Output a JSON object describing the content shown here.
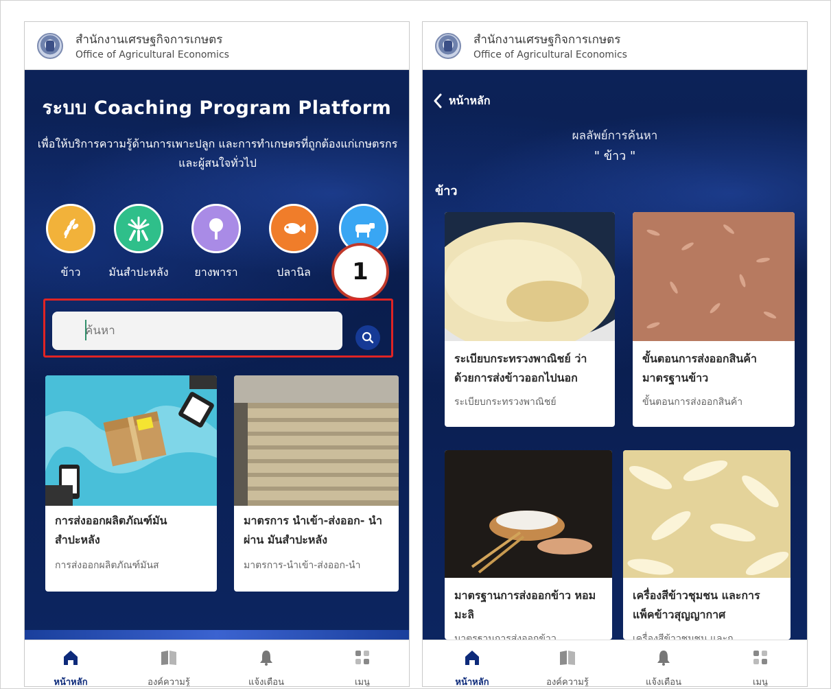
{
  "org": {
    "name_th": "สำนักงานเศรษฐกิจการเกษตร",
    "name_en": "Office of Agricultural Economics"
  },
  "left": {
    "title": "ระบบ Coaching Program Platform",
    "subtitle": "เพื่อให้บริการความรู้ด้านการเพาะปลูก และการทำเกษตรที่ถูกต้องแก่เกษตรกร และผู้สนใจทั่วไป",
    "categories": [
      {
        "label": "ข้าว",
        "icon": "rice-icon",
        "color": "#f2b23a"
      },
      {
        "label": "มันสำปะหลัง",
        "icon": "cassava-icon",
        "color": "#2fbf8a"
      },
      {
        "label": "ยางพารา",
        "icon": "rubber-icon",
        "color": "#a98be6"
      },
      {
        "label": "ปลานิล",
        "icon": "fish-icon",
        "color": "#f07d2a"
      },
      {
        "label": "",
        "icon": "cow-icon",
        "color": "#39a6f3"
      }
    ],
    "badge": "1",
    "search": {
      "placeholder": "ค้นหา"
    },
    "cards": [
      {
        "title": "การส่งออกผลิตภัณฑ์มัน สำปะหลัง",
        "subtitle": "การส่งออกผลิตภัณฑ์มันส"
      },
      {
        "title": "มาตรการ นำเข้า-ส่งออก- นำผ่าน มันสำปะหลัง",
        "subtitle": "มาตรการ-นำเข้า-ส่งออก-นำ"
      }
    ]
  },
  "right": {
    "back_label": "หน้าหลัก",
    "result_title": "ผลลัพย์การค้นหา",
    "result_query": "\" ข้าว \"",
    "section": "ข้าว",
    "cards": [
      {
        "title": "ระเบียบกระทรวงพาณิชย์ ว่า ด้วยการส่งข้าวออกไปนอก",
        "subtitle": "ระเบียบกระทรวงพาณิชย์"
      },
      {
        "title": "ขั้นตอนการส่งออกสินค้า มาตรฐานข้าว",
        "subtitle": "ขั้นตอนการส่งออกสินค้า"
      },
      {
        "title": "มาตรฐานการส่งออกข้าว หอมมะลิ",
        "subtitle": "มาตรฐานการส่งออกข้าว"
      },
      {
        "title": "เครื่องสีข้าวชุมชน และการ แพ็คข้าวสุญญากาศ",
        "subtitle": "เครื่องสีข้าวชุมชน และก"
      }
    ]
  },
  "nav": [
    {
      "label": "หน้าหลัก",
      "icon": "home-icon",
      "active": true
    },
    {
      "label": "องค์ความรู้",
      "icon": "book-icon",
      "active": false
    },
    {
      "label": "แจ้งเตือน",
      "icon": "bell-icon",
      "active": false
    },
    {
      "label": "เมนู",
      "icon": "menu-grid-icon",
      "active": false
    }
  ],
  "colors": {
    "navy": "#0b1f4e",
    "highlight": "#e02424",
    "accent": "#163a96"
  }
}
